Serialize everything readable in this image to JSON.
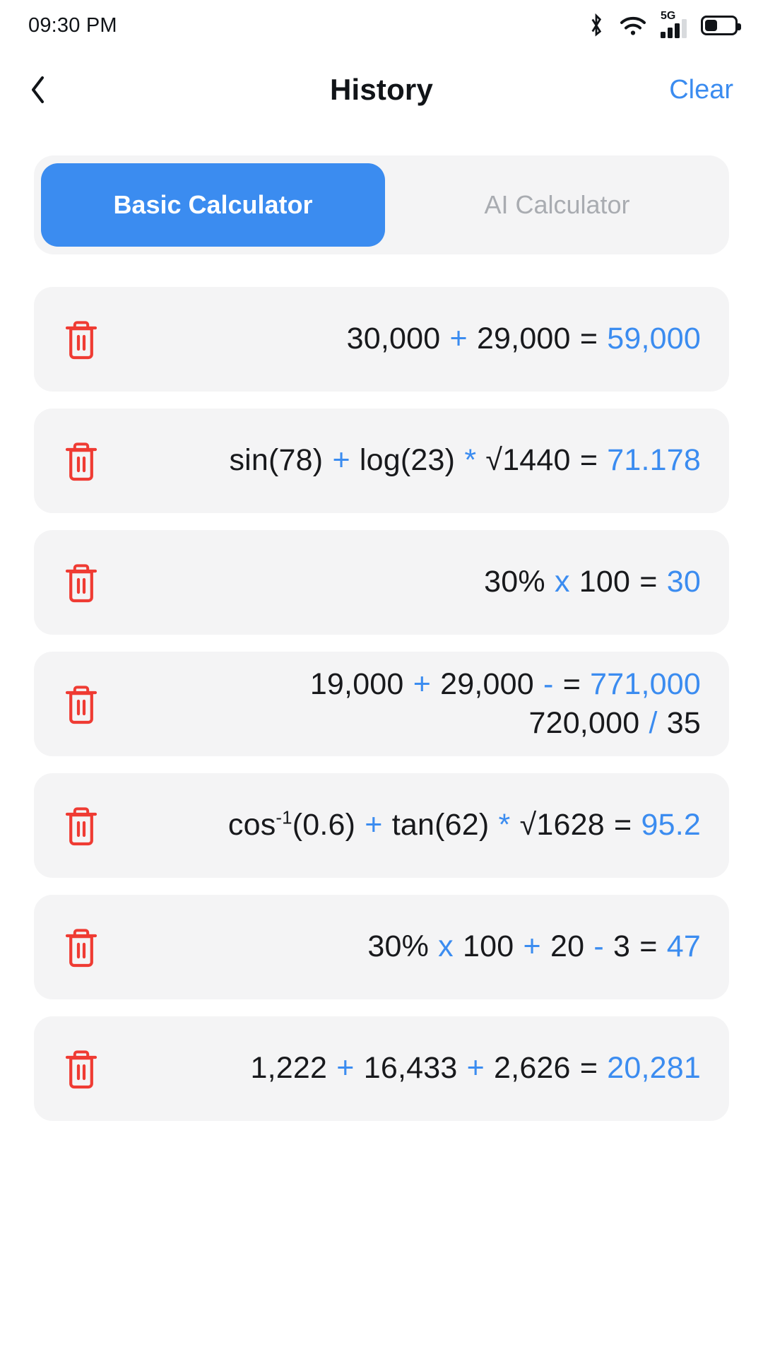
{
  "status_bar": {
    "time": "09:30 PM",
    "icons": [
      {
        "name": "bluetooth-icon",
        "label": "Bluetooth"
      },
      {
        "name": "wifi-icon",
        "label": "Wi-Fi"
      },
      {
        "name": "cellular-signal-icon",
        "label": "5G"
      },
      {
        "name": "battery-icon",
        "label": "Battery"
      }
    ],
    "network_label": "5G",
    "signal_bars_filled": 3,
    "signal_bars_total": 4,
    "battery_level_percent": 42
  },
  "header": {
    "back_icon": "chevron-left-icon",
    "title": "History",
    "clear_label": "Clear"
  },
  "tabs": {
    "selected_index": 0,
    "items": [
      {
        "label": "Basic Calculator",
        "active": true
      },
      {
        "label": "AI Calculator",
        "active": false
      }
    ]
  },
  "colors": {
    "accent_blue": "#3b8cf0",
    "delete_red": "#ef3b33",
    "card_background": "#f4f4f5",
    "text_primary": "#18191c",
    "tab_inactive_text": "#a9acb1"
  },
  "history": {
    "delete_icon": "trash-icon",
    "items": [
      {
        "id": 1,
        "lines": [
          [
            {
              "t": "30,000 ",
              "k": "num"
            },
            {
              "t": "+",
              "k": "op"
            },
            {
              "t": " 29,000 ",
              "k": "num"
            },
            {
              "t": "=",
              "k": "eq"
            },
            {
              "t": " 59,000",
              "k": "res"
            }
          ]
        ],
        "expression_plain": "30,000 + 29,000",
        "result_plain": "59,000"
      },
      {
        "id": 2,
        "lines": [
          [
            {
              "t": "sin(78) ",
              "k": "num"
            },
            {
              "t": "+",
              "k": "op"
            },
            {
              "t": " log(23) ",
              "k": "num"
            },
            {
              "t": "*",
              "k": "op"
            },
            {
              "t": " √1440 ",
              "k": "num"
            },
            {
              "t": "=",
              "k": "eq"
            },
            {
              "t": " 71.178",
              "k": "res"
            }
          ]
        ],
        "expression_plain": "sin(78) + log(23) * √1440",
        "result_plain": "71.178"
      },
      {
        "id": 3,
        "lines": [
          [
            {
              "t": "30% ",
              "k": "num"
            },
            {
              "t": "x",
              "k": "op"
            },
            {
              "t": " 100 ",
              "k": "num"
            },
            {
              "t": "=",
              "k": "eq"
            },
            {
              "t": " 30",
              "k": "res"
            }
          ]
        ],
        "expression_plain": "30% x 100",
        "result_plain": "30"
      },
      {
        "id": 4,
        "lines": [
          [
            {
              "t": "19,000 ",
              "k": "num"
            },
            {
              "t": "+",
              "k": "op"
            },
            {
              "t": " 29,000 ",
              "k": "num"
            },
            {
              "t": "-",
              "k": "op"
            },
            {
              "t": "  ",
              "k": "num"
            },
            {
              "t": "=",
              "k": "eq"
            },
            {
              "t": " 771,000",
              "k": "res"
            }
          ],
          [
            {
              "t": "720,000 ",
              "k": "num"
            },
            {
              "t": "/",
              "k": "op"
            },
            {
              "t": " 35",
              "k": "num"
            }
          ]
        ],
        "expression_plain": "19,000 + 29,000 - 720,000 / 35",
        "result_plain": "771,000"
      },
      {
        "id": 5,
        "lines": [
          [
            {
              "t": "cos",
              "k": "num"
            },
            {
              "t": "-1",
              "k": "sup"
            },
            {
              "t": "(0.6) ",
              "k": "num"
            },
            {
              "t": "+",
              "k": "op"
            },
            {
              "t": " tan(62) ",
              "k": "num"
            },
            {
              "t": "*",
              "k": "op"
            },
            {
              "t": " √1628 ",
              "k": "num"
            },
            {
              "t": "=",
              "k": "eq"
            },
            {
              "t": " 95.2",
              "k": "res"
            }
          ]
        ],
        "expression_plain": "cos-1(0.6) + tan(62) * √1628",
        "result_plain": "95.2"
      },
      {
        "id": 6,
        "lines": [
          [
            {
              "t": "30% ",
              "k": "num"
            },
            {
              "t": "x",
              "k": "op"
            },
            {
              "t": " 100 ",
              "k": "num"
            },
            {
              "t": "+",
              "k": "op"
            },
            {
              "t": " 20 ",
              "k": "num"
            },
            {
              "t": "-",
              "k": "op"
            },
            {
              "t": " 3 ",
              "k": "num"
            },
            {
              "t": "=",
              "k": "eq"
            },
            {
              "t": " 47",
              "k": "res"
            }
          ]
        ],
        "expression_plain": "30% x 100 + 20 - 3",
        "result_plain": "47"
      },
      {
        "id": 7,
        "lines": [
          [
            {
              "t": "1,222 ",
              "k": "num"
            },
            {
              "t": "+",
              "k": "op"
            },
            {
              "t": " 16,433 ",
              "k": "num"
            },
            {
              "t": "+",
              "k": "op"
            },
            {
              "t": " 2,626 ",
              "k": "num"
            },
            {
              "t": "=",
              "k": "eq"
            },
            {
              "t": " 20,281",
              "k": "res"
            }
          ]
        ],
        "expression_plain": "1,222 + 16,433 + 2,626",
        "result_plain": "20,281"
      }
    ]
  }
}
